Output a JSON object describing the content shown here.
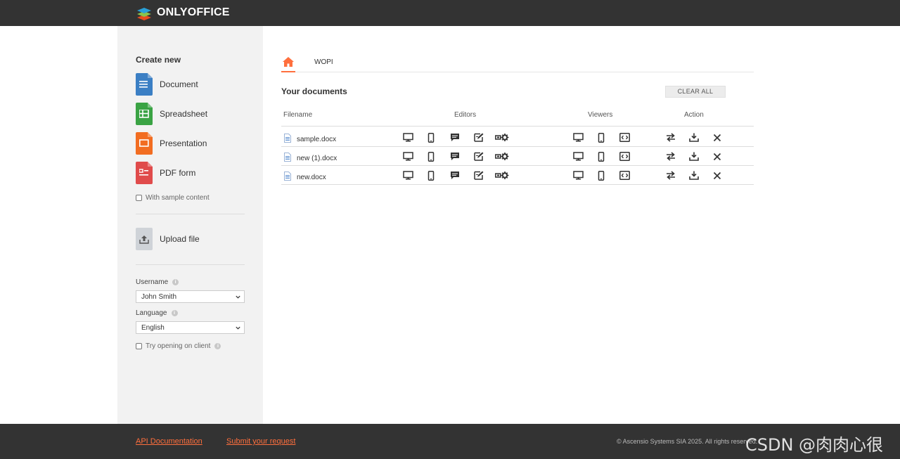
{
  "header": {
    "logo_text": "ONLYOFFICE"
  },
  "sidebar": {
    "create_title": "Create new",
    "create_items": [
      {
        "label": "Document",
        "color": "#3b7fc4"
      },
      {
        "label": "Spreadsheet",
        "color": "#3aa344"
      },
      {
        "label": "Presentation",
        "color": "#f26d21"
      },
      {
        "label": "PDF form",
        "color": "#e04b4b"
      }
    ],
    "sample_content_label": "With sample content",
    "upload_label": "Upload file",
    "username_label": "Username",
    "username_value": "John Smith",
    "language_label": "Language",
    "language_value": "English",
    "try_client_label": "Try opening on client"
  },
  "tabs": {
    "home_icon": "home-icon",
    "wopi_label": "WOPI",
    "accent": "#ff6f3d"
  },
  "documents": {
    "title": "Your documents",
    "clear_all_label": "CLEAR ALL",
    "columns": {
      "filename": "Filename",
      "editors": "Editors",
      "viewers": "Viewers",
      "action": "Action"
    },
    "rows": [
      {
        "filename": "sample.docx"
      },
      {
        "filename": "new (1).docx"
      },
      {
        "filename": "new.docx"
      }
    ],
    "editor_icons": [
      "desktop-icon",
      "mobile-icon",
      "comment-icon",
      "review-icon",
      "fill-form-icon"
    ],
    "viewer_icons": [
      "desktop-view-icon",
      "mobile-view-icon",
      "embedded-view-icon"
    ],
    "action_icons": [
      "convert-icon",
      "download-icon",
      "delete-icon"
    ]
  },
  "footer": {
    "api_docs_label": "API Documentation",
    "submit_request_label": "Submit your request",
    "copyright": "© Ascensio Systems SIA 2025. All rights reserved.",
    "watermark": "CSDN @肉肉心很软"
  }
}
